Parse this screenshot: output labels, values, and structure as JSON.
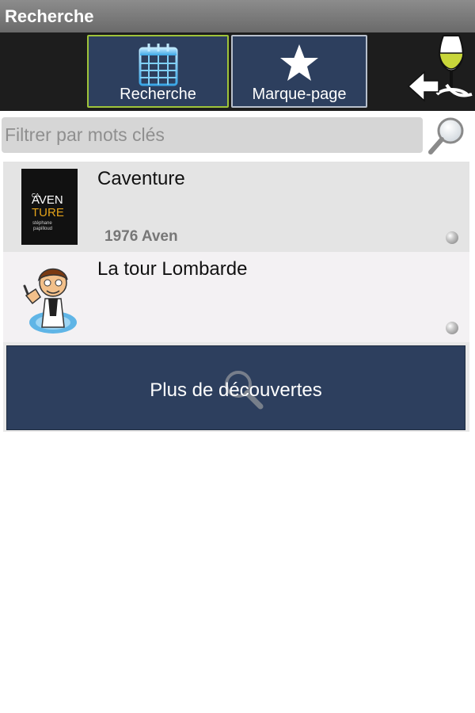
{
  "app": {
    "title": "Recherche"
  },
  "toolbar": {
    "search_label": "Recherche",
    "bookmark_label": "Marque-page",
    "accent_color": "#9fc43a",
    "button_color": "#2d3f5e"
  },
  "search": {
    "placeholder": "Filtrer par mots clés",
    "value": ""
  },
  "results": [
    {
      "title": "Caventure",
      "subtitle": "1976 Aven",
      "logo_text": {
        "line1": "AVEN",
        "line2": "TURE",
        "tagline1": "stéphane",
        "tagline2": "papilloud",
        "small": "CA"
      }
    },
    {
      "title": "La tour Lombarde",
      "subtitle": ""
    }
  ],
  "more": {
    "label": "Plus de découvertes"
  },
  "icons": {
    "toolbar_search": "calendar-icon",
    "toolbar_bookmark": "star-icon",
    "back": "back-arrow-icon",
    "wine": "wine-glass-icon",
    "search_button": "magnifier-icon",
    "more": "magnifier-icon"
  }
}
